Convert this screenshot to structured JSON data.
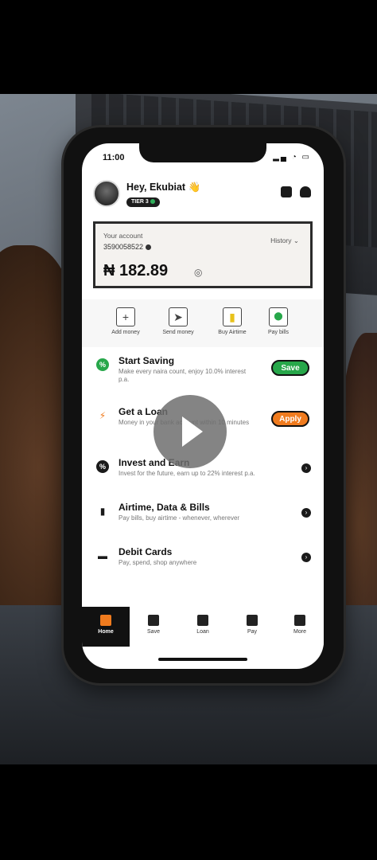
{
  "status": {
    "time": "11:00"
  },
  "header": {
    "greeting": "Hey, Ekubiat 👋",
    "tier": "TIER 3"
  },
  "account": {
    "label": "Your account",
    "number": "3590058522",
    "history": "History ⌄",
    "balance": "₦ 182.89"
  },
  "quick_actions": [
    {
      "label": "Add money",
      "icon": "plus-icon",
      "glyph": "+"
    },
    {
      "label": "Send money",
      "icon": "send-icon",
      "glyph": "➤"
    },
    {
      "label": "Buy Airtime",
      "icon": "phone-icon",
      "glyph": "▮"
    },
    {
      "label": "Pay bills",
      "icon": "location-icon",
      "glyph": "⬤"
    }
  ],
  "list": [
    {
      "title": "Start Saving",
      "sub": "Make every naira count, enjoy 10.0% interest p.a.",
      "button": "Save",
      "button_color": "#27a74a",
      "icon_color": "#27a74a",
      "icon_glyph": "%"
    },
    {
      "title": "Get a Loan",
      "sub": "Money in your bank account within 10 minutes",
      "button": "Apply",
      "button_color": "#f07b1e",
      "icon_color": "#f07b1e",
      "icon_glyph": "⚡"
    },
    {
      "title": "Invest and Earn",
      "sub": "Invest for the future, earn up to 22% interest p.a.",
      "icon_color": "#1a1a1a",
      "icon_glyph": "%"
    },
    {
      "title": "Airtime, Data & Bills",
      "sub": "Pay bills, buy airtime - whenever, wherever",
      "icon_color": "#1a1a1a",
      "icon_glyph": "▮"
    },
    {
      "title": "Debit Cards",
      "sub": "Pay, spend, shop anywhere",
      "icon_color": "#1a1a1a",
      "icon_glyph": "▬"
    }
  ],
  "tabs": [
    {
      "label": "Home",
      "active": true
    },
    {
      "label": "Save"
    },
    {
      "label": "Loan"
    },
    {
      "label": "Pay"
    },
    {
      "label": "More"
    }
  ],
  "colors": {
    "accent_orange": "#f07b1e",
    "accent_green": "#27a74a"
  }
}
